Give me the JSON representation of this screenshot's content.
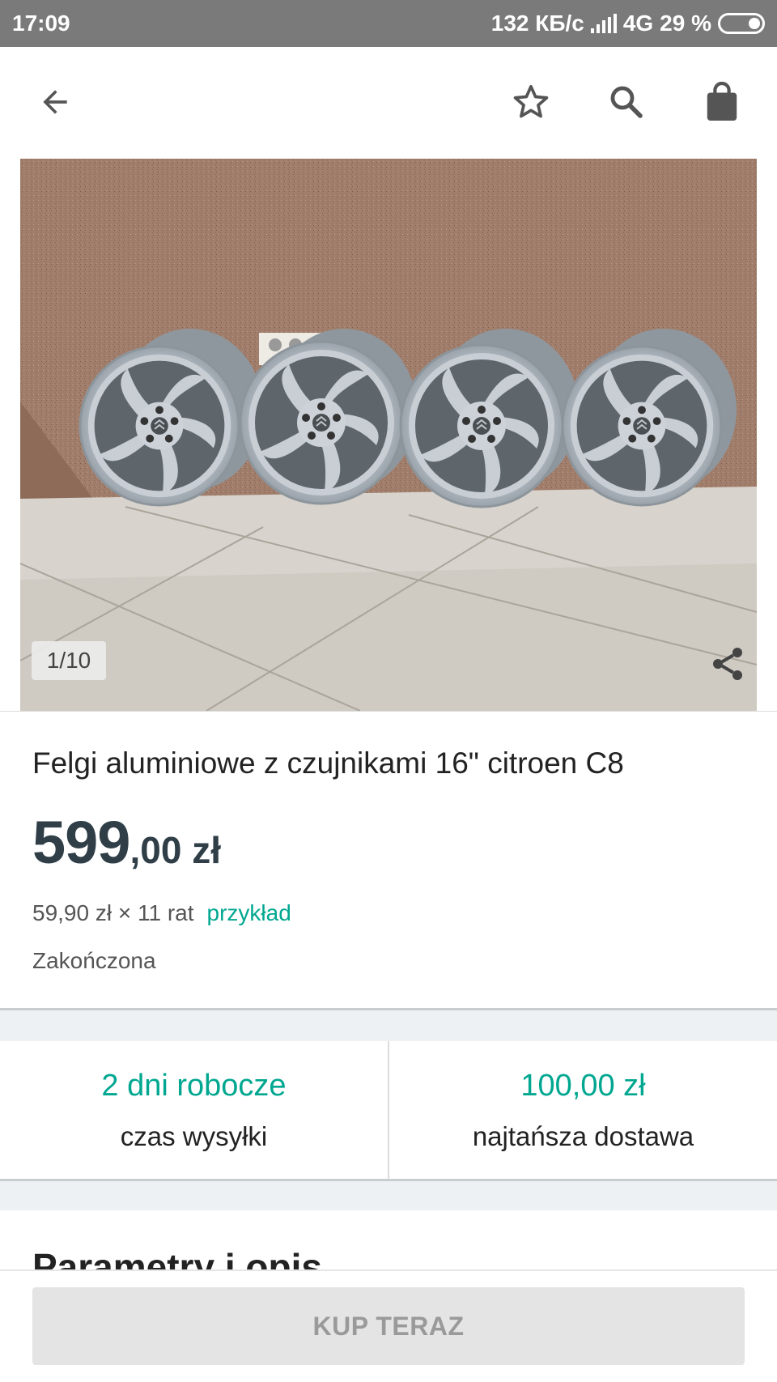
{
  "status_bar": {
    "time": "17:09",
    "network_speed": "132 КБ/с",
    "network_type": "4G",
    "battery": "29 %"
  },
  "toolbar": {
    "back_icon": "arrow-left-icon",
    "favorite_icon": "star-outline-icon",
    "search_icon": "search-icon",
    "cart_icon": "shopping-bag-icon"
  },
  "gallery": {
    "counter": "1/10",
    "share_icon": "share-icon"
  },
  "listing": {
    "title": "Felgi aluminiowe z czujnikami 16\" citroen C8",
    "price_integer": "599",
    "price_fraction": ",00 zł",
    "installment": "59,90 zł × 11 rat",
    "installment_link": "przykład",
    "status": "Zakończona"
  },
  "delivery": {
    "shipping_time_value": "2 dni robocze",
    "shipping_time_label": "czas wysyłki",
    "cheapest_value": "100,00 zł",
    "cheapest_label": "najtańsza dostawa"
  },
  "section": {
    "title": "Parametry i opis"
  },
  "actions": {
    "buy_now": "KUP TERAZ"
  },
  "colors": {
    "accent": "#00a790",
    "price": "#2f3e47",
    "status_bar": "#7a7a7a"
  }
}
